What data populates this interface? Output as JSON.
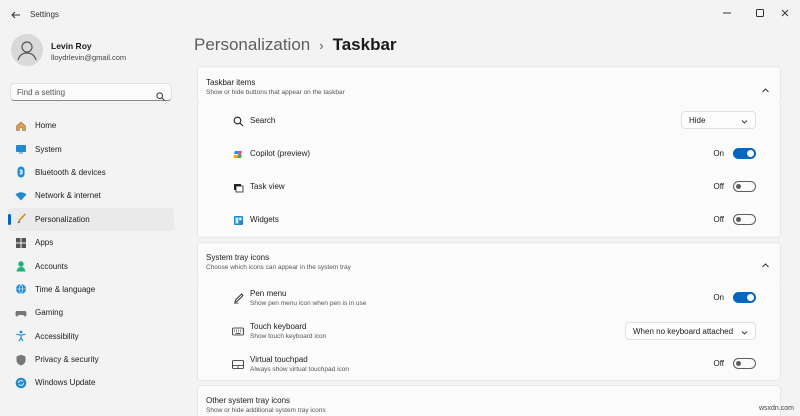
{
  "app": {
    "title": "Settings"
  },
  "profile": {
    "name": "Levin Roy",
    "email": "lloydrlevin@gmail.com"
  },
  "search": {
    "placeholder": "Find a setting"
  },
  "nav": [
    {
      "label": "Home",
      "icon": "home-icon"
    },
    {
      "label": "System",
      "icon": "system-icon"
    },
    {
      "label": "Bluetooth & devices",
      "icon": "bluetooth-icon"
    },
    {
      "label": "Network & internet",
      "icon": "wifi-icon"
    },
    {
      "label": "Personalization",
      "icon": "brush-icon",
      "active": true
    },
    {
      "label": "Apps",
      "icon": "apps-icon"
    },
    {
      "label": "Accounts",
      "icon": "accounts-icon"
    },
    {
      "label": "Time & language",
      "icon": "globe-icon"
    },
    {
      "label": "Gaming",
      "icon": "gaming-icon"
    },
    {
      "label": "Accessibility",
      "icon": "accessibility-icon"
    },
    {
      "label": "Privacy & security",
      "icon": "shield-icon"
    },
    {
      "label": "Windows Update",
      "icon": "update-icon"
    }
  ],
  "breadcrumb": {
    "parent": "Personalization",
    "separator": "›",
    "current": "Taskbar"
  },
  "taskbar_items": {
    "title": "Taskbar items",
    "subtitle": "Show or hide buttons that appear on the taskbar",
    "rows": [
      {
        "label": "Search",
        "control": "dropdown",
        "value": "Hide",
        "icon": "search-icon"
      },
      {
        "label": "Copilot (preview)",
        "control": "toggle",
        "state": "On",
        "icon": "copilot-icon"
      },
      {
        "label": "Task view",
        "control": "toggle",
        "state": "Off",
        "icon": "task-view-icon"
      },
      {
        "label": "Widgets",
        "control": "toggle",
        "state": "Off",
        "icon": "widgets-icon"
      }
    ]
  },
  "system_tray": {
    "title": "System tray icons",
    "subtitle": "Choose which icons can appear in the system tray",
    "rows": [
      {
        "label": "Pen menu",
        "sub": "Show pen menu icon when pen is in use",
        "control": "toggle",
        "state": "On",
        "icon": "pen-icon"
      },
      {
        "label": "Touch keyboard",
        "sub": "Show touch keyboard icon",
        "control": "dropdown",
        "value": "When no keyboard attached",
        "icon": "keyboard-icon"
      },
      {
        "label": "Virtual touchpad",
        "sub": "Always show virtual touchpad icon",
        "control": "toggle",
        "state": "Off",
        "icon": "touchpad-icon"
      }
    ]
  },
  "other_tray": {
    "title": "Other system tray icons",
    "subtitle": "Show or hide additional system tray icons"
  },
  "watermark": "wsxdn.com",
  "colors": {
    "accent": "#0067c0",
    "background": "#f3f3f3",
    "card": "#fbfbfb"
  }
}
